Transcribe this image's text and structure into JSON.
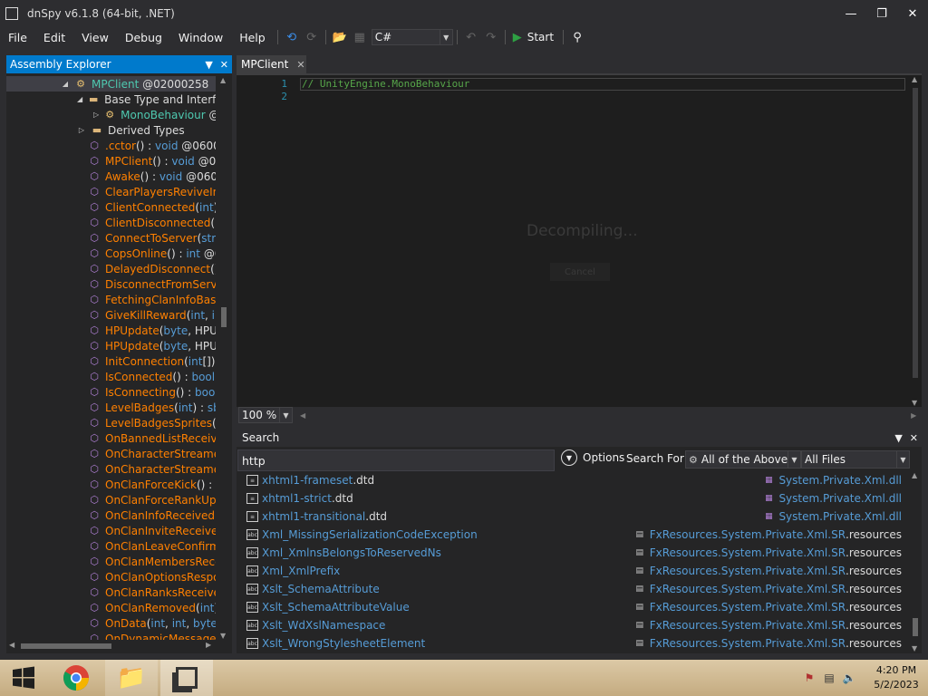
{
  "window": {
    "title": "dnSpy v6.1.8 (64-bit, .NET)"
  },
  "menu": [
    "File",
    "Edit",
    "View",
    "Debug",
    "Window",
    "Help"
  ],
  "toolbar": {
    "language": "C#",
    "start_label": "Start"
  },
  "assembly_explorer": {
    "title": "Assembly Explorer",
    "rows": [
      {
        "indent": 60,
        "expander": "◢",
        "icon": "class",
        "parts": [
          [
            "tname",
            "MPClient"
          ],
          [
            "plain",
            " @02000258"
          ]
        ],
        "selected": true
      },
      {
        "indent": 78,
        "expander": "◢",
        "icon": "folder",
        "parts": [
          [
            "plain",
            "Base Type and Interfaces"
          ]
        ]
      },
      {
        "indent": 96,
        "expander": "▷",
        "icon": "class",
        "parts": [
          [
            "tname",
            "MonoBehaviour"
          ],
          [
            "plain",
            " @"
          ]
        ]
      },
      {
        "indent": 78,
        "expander": "▷",
        "icon": "folder",
        "parts": [
          [
            "plain",
            "Derived Types"
          ]
        ]
      },
      {
        "indent": 88,
        "expander": "",
        "icon": "method",
        "parts": [
          [
            "mname",
            ".cctor"
          ],
          [
            "plain",
            "() : "
          ],
          [
            "kw",
            "void"
          ],
          [
            "plain",
            " @06000"
          ]
        ]
      },
      {
        "indent": 88,
        "expander": "",
        "icon": "method",
        "parts": [
          [
            "mname",
            "MPClient"
          ],
          [
            "plain",
            "() : "
          ],
          [
            "kw",
            "void"
          ],
          [
            "plain",
            " @06"
          ]
        ]
      },
      {
        "indent": 88,
        "expander": "",
        "icon": "method",
        "parts": [
          [
            "mname",
            "Awake"
          ],
          [
            "plain",
            "() : "
          ],
          [
            "kw",
            "void"
          ],
          [
            "plain",
            " @06000"
          ]
        ]
      },
      {
        "indent": 88,
        "expander": "",
        "icon": "method",
        "parts": [
          [
            "mname",
            "ClearPlayersReviveInfo"
          ]
        ]
      },
      {
        "indent": 88,
        "expander": "",
        "icon": "method",
        "parts": [
          [
            "mname",
            "ClientConnected"
          ],
          [
            "plain",
            "("
          ],
          [
            "kw",
            "int"
          ],
          [
            "plain",
            ") :"
          ]
        ]
      },
      {
        "indent": 88,
        "expander": "",
        "icon": "method",
        "parts": [
          [
            "mname",
            "ClientDisconnected"
          ],
          [
            "plain",
            "(in"
          ]
        ]
      },
      {
        "indent": 88,
        "expander": "",
        "icon": "method",
        "parts": [
          [
            "mname",
            "ConnectToServer"
          ],
          [
            "plain",
            "("
          ],
          [
            "kw",
            "string"
          ]
        ]
      },
      {
        "indent": 88,
        "expander": "",
        "icon": "method",
        "parts": [
          [
            "mname",
            "CopsOnline"
          ],
          [
            "plain",
            "() : "
          ],
          [
            "kw",
            "int"
          ],
          [
            "plain",
            " @06"
          ]
        ]
      },
      {
        "indent": 88,
        "expander": "",
        "icon": "method",
        "parts": [
          [
            "mname",
            "DelayedDisconnect"
          ],
          [
            "plain",
            "() :"
          ]
        ]
      },
      {
        "indent": 88,
        "expander": "",
        "icon": "method",
        "parts": [
          [
            "mname",
            "DisconnectFromServer"
          ]
        ]
      },
      {
        "indent": 88,
        "expander": "",
        "icon": "method",
        "parts": [
          [
            "mname",
            "FetchingClanInfoBasic"
          ]
        ]
      },
      {
        "indent": 88,
        "expander": "",
        "icon": "method",
        "parts": [
          [
            "mname",
            "GiveKillReward"
          ],
          [
            "plain",
            "("
          ],
          [
            "kw",
            "int"
          ],
          [
            "plain",
            ", "
          ],
          [
            "kw",
            "int"
          ]
        ]
      },
      {
        "indent": 88,
        "expander": "",
        "icon": "method",
        "parts": [
          [
            "mname",
            "HPUpdate"
          ],
          [
            "plain",
            "("
          ],
          [
            "kw",
            "byte"
          ],
          [
            "plain",
            ", HPUp"
          ]
        ]
      },
      {
        "indent": 88,
        "expander": "",
        "icon": "method",
        "parts": [
          [
            "mname",
            "HPUpdate"
          ],
          [
            "plain",
            "("
          ],
          [
            "kw",
            "byte"
          ],
          [
            "plain",
            ", HPUp"
          ]
        ]
      },
      {
        "indent": 88,
        "expander": "",
        "icon": "method",
        "parts": [
          [
            "mname",
            "InitConnection"
          ],
          [
            "plain",
            "("
          ],
          [
            "kw",
            "int"
          ],
          [
            "plain",
            "[]) :"
          ]
        ]
      },
      {
        "indent": 88,
        "expander": "",
        "icon": "method",
        "parts": [
          [
            "mname",
            "IsConnected"
          ],
          [
            "plain",
            "() : "
          ],
          [
            "kw",
            "bool"
          ],
          [
            "plain",
            " @"
          ]
        ]
      },
      {
        "indent": 88,
        "expander": "",
        "icon": "method",
        "parts": [
          [
            "mname",
            "IsConnecting"
          ],
          [
            "plain",
            "() : "
          ],
          [
            "kw",
            "bool"
          ],
          [
            "plain",
            " @"
          ]
        ]
      },
      {
        "indent": 88,
        "expander": "",
        "icon": "method",
        "parts": [
          [
            "mname",
            "LevelBadges"
          ],
          [
            "plain",
            "("
          ],
          [
            "kw",
            "int"
          ],
          [
            "plain",
            ") : "
          ],
          [
            "kw",
            "sbyte"
          ]
        ]
      },
      {
        "indent": 88,
        "expander": "",
        "icon": "method",
        "parts": [
          [
            "mname",
            "LevelBadgesSprites"
          ],
          [
            "plain",
            "("
          ],
          [
            "kw",
            "sbyte"
          ]
        ]
      },
      {
        "indent": 88,
        "expander": "",
        "icon": "method",
        "parts": [
          [
            "mname",
            "OnBannedListReceived"
          ]
        ]
      },
      {
        "indent": 88,
        "expander": "",
        "icon": "method",
        "parts": [
          [
            "mname",
            "OnCharacterStreamed"
          ]
        ]
      },
      {
        "indent": 88,
        "expander": "",
        "icon": "method",
        "parts": [
          [
            "mname",
            "OnCharacterStreamed"
          ]
        ]
      },
      {
        "indent": 88,
        "expander": "",
        "icon": "method",
        "parts": [
          [
            "mname",
            "OnClanForceKick"
          ],
          [
            "plain",
            "() : "
          ],
          [
            "kw",
            "vo"
          ]
        ]
      },
      {
        "indent": 88,
        "expander": "",
        "icon": "method",
        "parts": [
          [
            "mname",
            "OnClanForceRankUpdate"
          ]
        ]
      },
      {
        "indent": 88,
        "expander": "",
        "icon": "method",
        "parts": [
          [
            "mname",
            "OnClanInfoReceived"
          ],
          [
            "plain",
            "(M"
          ]
        ]
      },
      {
        "indent": 88,
        "expander": "",
        "icon": "method",
        "parts": [
          [
            "mname",
            "OnClanInviteReceived"
          ]
        ]
      },
      {
        "indent": 88,
        "expander": "",
        "icon": "method",
        "parts": [
          [
            "mname",
            "OnClanLeaveConfirmed"
          ]
        ]
      },
      {
        "indent": 88,
        "expander": "",
        "icon": "method",
        "parts": [
          [
            "mname",
            "OnClanMembersReceived"
          ]
        ]
      },
      {
        "indent": 88,
        "expander": "",
        "icon": "method",
        "parts": [
          [
            "mname",
            "OnClanOptionsResponse"
          ]
        ]
      },
      {
        "indent": 88,
        "expander": "",
        "icon": "method",
        "parts": [
          [
            "mname",
            "OnClanRanksReceived"
          ]
        ]
      },
      {
        "indent": 88,
        "expander": "",
        "icon": "method",
        "parts": [
          [
            "mname",
            "OnClanRemoved"
          ],
          [
            "plain",
            "("
          ],
          [
            "kw",
            "int"
          ],
          [
            "plain",
            ") :"
          ]
        ]
      },
      {
        "indent": 88,
        "expander": "",
        "icon": "method",
        "parts": [
          [
            "mname",
            "OnData"
          ],
          [
            "plain",
            "("
          ],
          [
            "kw",
            "int"
          ],
          [
            "plain",
            ", "
          ],
          [
            "kw",
            "int"
          ],
          [
            "plain",
            ", "
          ],
          [
            "kw",
            "byte"
          ],
          [
            "plain",
            "[],"
          ]
        ]
      },
      {
        "indent": 88,
        "expander": "",
        "icon": "method",
        "parts": [
          [
            "mname",
            "OnDynamicMessageR"
          ]
        ]
      }
    ]
  },
  "editor": {
    "tab_label": "MPClient",
    "line_numbers": [
      "1",
      "2"
    ],
    "code_line": "// UnityEngine.MonoBehaviour",
    "status": "Decompiling...",
    "cancel_label": "Cancel",
    "zoom": "100 %"
  },
  "search": {
    "title": "Search",
    "query": "http",
    "options_label": "Options",
    "search_for_label": "Search For:",
    "search_for_value": "All of the Above",
    "scope_value": "All Files",
    "results": [
      {
        "icon": "file",
        "name": "xhtml1-frameset",
        "ext": ".dtd",
        "loc_icon": "dll",
        "loc_ns": "",
        "loc_name": "System.Private.Xml.dll"
      },
      {
        "icon": "file",
        "name": "xhtml1-strict",
        "ext": ".dtd",
        "loc_icon": "dll",
        "loc_ns": "",
        "loc_name": "System.Private.Xml.dll"
      },
      {
        "icon": "file",
        "name": "xhtml1-transitional",
        "ext": ".dtd",
        "loc_icon": "dll",
        "loc_ns": "",
        "loc_name": "System.Private.Xml.dll"
      },
      {
        "icon": "abc",
        "name": "Xml_MissingSerializationCodeException",
        "ext": "",
        "loc_icon": "res",
        "loc_ns": "FxResources.System.Private.Xml.SR",
        "loc_name": ".resources"
      },
      {
        "icon": "abc",
        "name": "Xml_XmlnsBelongsToReservedNs",
        "ext": "",
        "loc_icon": "res",
        "loc_ns": "FxResources.System.Private.Xml.SR",
        "loc_name": ".resources"
      },
      {
        "icon": "abc",
        "name": "Xml_XmlPrefix",
        "ext": "",
        "loc_icon": "res",
        "loc_ns": "FxResources.System.Private.Xml.SR",
        "loc_name": ".resources"
      },
      {
        "icon": "abc",
        "name": "Xslt_SchemaAttribute",
        "ext": "",
        "loc_icon": "res",
        "loc_ns": "FxResources.System.Private.Xml.SR",
        "loc_name": ".resources"
      },
      {
        "icon": "abc",
        "name": "Xslt_SchemaAttributeValue",
        "ext": "",
        "loc_icon": "res",
        "loc_ns": "FxResources.System.Private.Xml.SR",
        "loc_name": ".resources"
      },
      {
        "icon": "abc",
        "name": "Xslt_WdXslNamespace",
        "ext": "",
        "loc_icon": "res",
        "loc_ns": "FxResources.System.Private.Xml.SR",
        "loc_name": ".resources"
      },
      {
        "icon": "abc",
        "name": "Xslt_WrongStylesheetElement",
        "ext": "",
        "loc_icon": "res",
        "loc_ns": "FxResources.System.Private.Xml.SR",
        "loc_name": ".resources"
      }
    ]
  },
  "taskbar": {
    "time": "4:20 PM",
    "date": "5/2/2023"
  },
  "colors": {
    "accent": "#007acc",
    "method": "#ff8000",
    "type": "#4ec9b0",
    "keyword": "#569cd6",
    "comment": "#57a64a"
  }
}
